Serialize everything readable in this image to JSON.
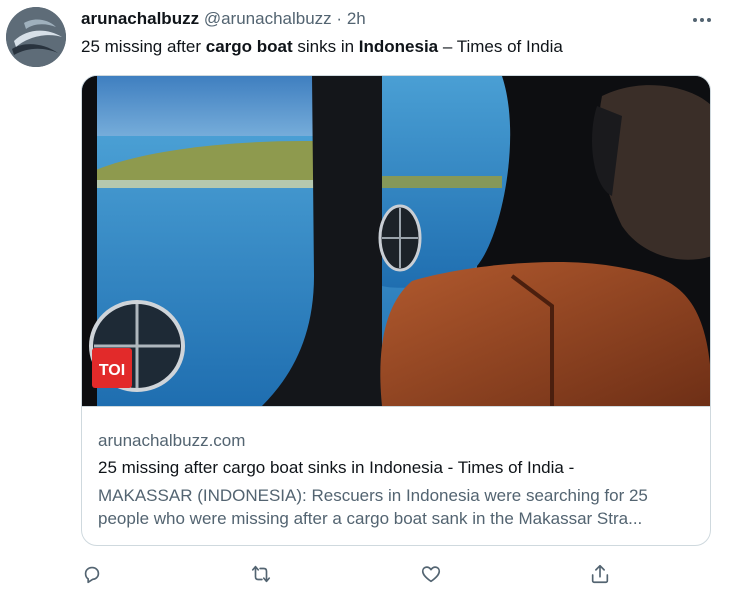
{
  "tweet": {
    "author_name": "arunachalbuzz",
    "author_handle": "@arunachalbuzz",
    "separator": "·",
    "time": "2h",
    "text_parts": [
      "25 missing after ",
      "cargo boat",
      " sinks in ",
      "Indonesia",
      " – Times of India"
    ],
    "more_icon": "more-horizontal-icon"
  },
  "card": {
    "image_badge": "TOI",
    "domain": "arunachalbuzz.com",
    "title": "25 missing after cargo boat sinks in Indonesia - Times of India -",
    "description_lines": [
      "MAKASSAR (INDONESIA): Rescuers in Indonesia were searching for 25",
      "people who were missing after a cargo boat sank in the Makassar Stra..."
    ]
  },
  "actions": {
    "reply_icon": "reply-icon",
    "retweet_icon": "retweet-icon",
    "like_icon": "like-icon",
    "share_icon": "share-icon"
  },
  "colors": {
    "text_primary": "#0f1419",
    "text_secondary": "#536471",
    "border": "#cfd9de",
    "toi_red": "#e22a2a"
  }
}
